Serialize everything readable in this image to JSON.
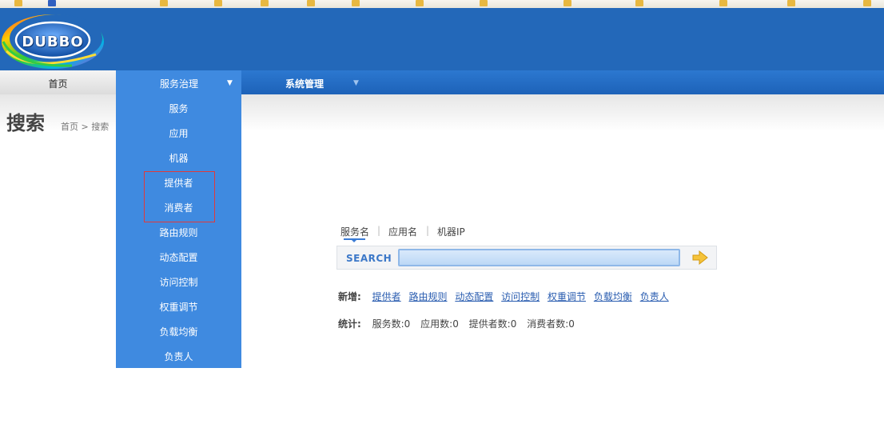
{
  "logo": {
    "text": "DUBBO"
  },
  "nav": {
    "home": "首页",
    "service_governance": "服务治理",
    "system_management": "系统管理",
    "dropdown_arrow": "▼"
  },
  "page": {
    "title": "搜索",
    "breadcrumb": "首页 > 搜索"
  },
  "dropdown": {
    "items": [
      "服务",
      "应用",
      "机器",
      "提供者",
      "消费者",
      "路由规则",
      "动态配置",
      "访问控制",
      "权重调节",
      "负载均衡",
      "负责人"
    ]
  },
  "search": {
    "tabs": [
      "服务名",
      "应用名",
      "机器IP"
    ],
    "separator": "|",
    "label": "SEARCH",
    "value": "",
    "button_icon": "arrow-right-icon"
  },
  "add": {
    "label": "新增:",
    "links": [
      "提供者",
      "路由规则",
      "动态配置",
      "访问控制",
      "权重调节",
      "负载均衡",
      "负责人"
    ]
  },
  "stats": {
    "label": "统计:",
    "items": [
      "服务数:0",
      "应用数:0",
      "提供者数:0",
      "消费者数:0"
    ]
  },
  "colors": {
    "header_blue": "#2368b9",
    "menu_blue": "#3f8ae0",
    "highlight_red": "#e03a3a",
    "arrow_yellow": "#f5c33b"
  }
}
